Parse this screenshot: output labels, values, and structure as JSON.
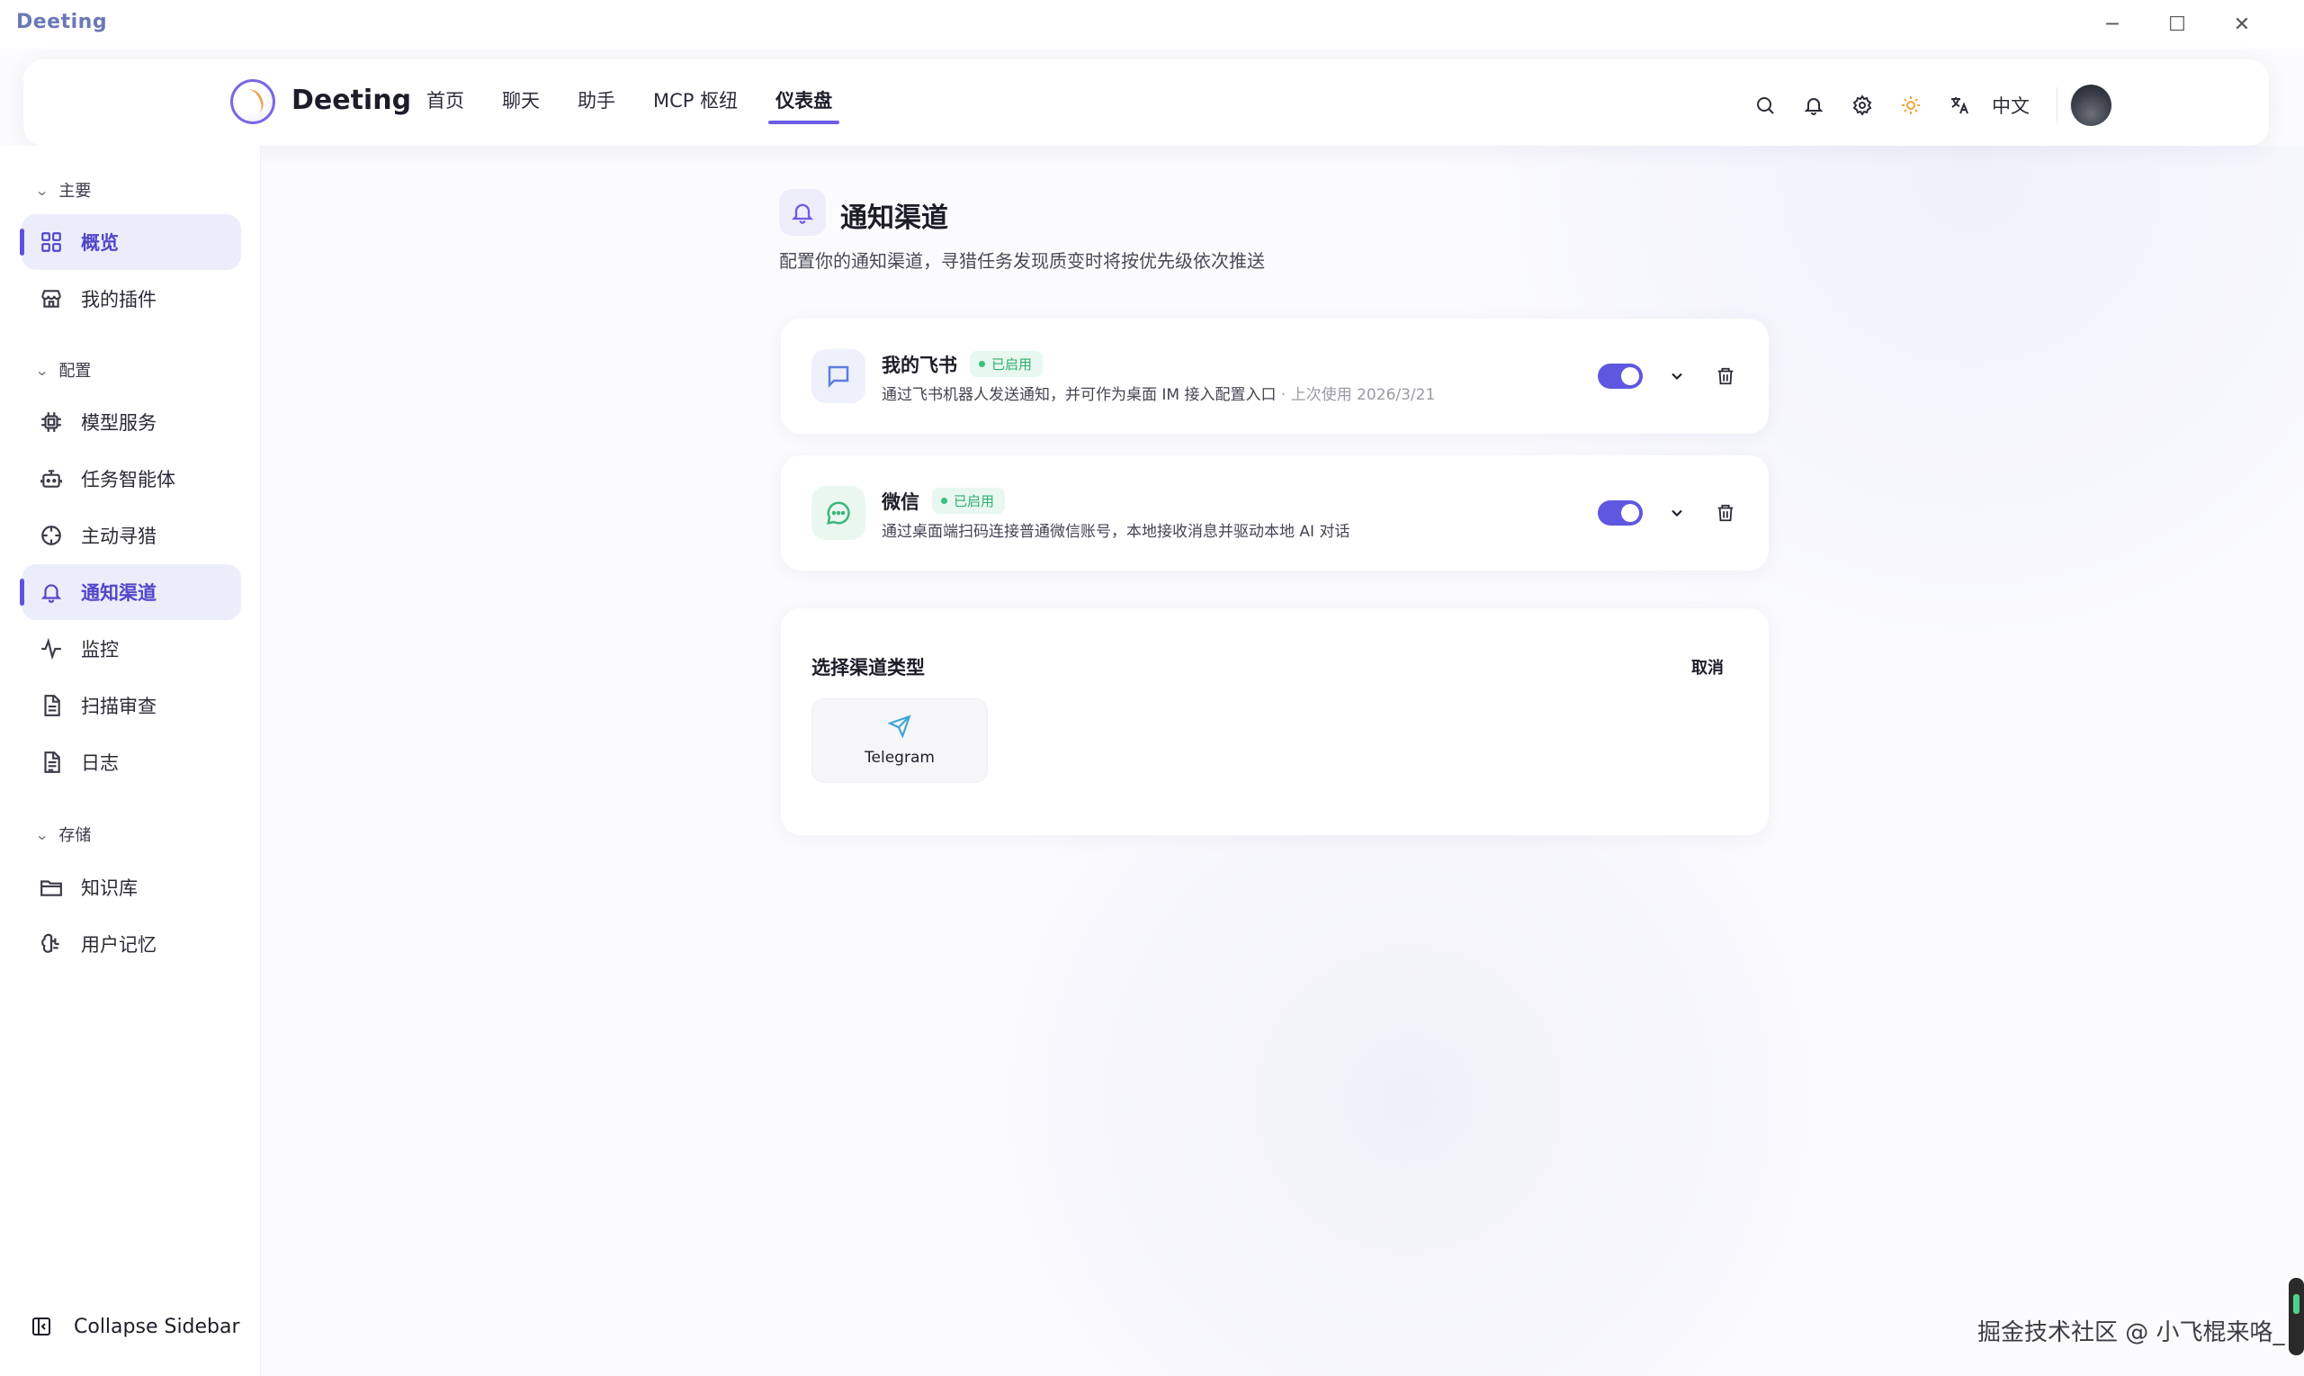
{
  "window": {
    "title": "Deeting",
    "controls": {
      "minimize": "─",
      "maximize": "☐",
      "close": "✕"
    }
  },
  "header": {
    "brand": "Deeting",
    "nav": [
      "首页",
      "聊天",
      "助手",
      "MCP 枢纽",
      "仪表盘"
    ],
    "active_nav": "仪表盘",
    "lang": "中文",
    "icons": [
      "search-icon",
      "bell-icon",
      "gear-icon",
      "sun-icon",
      "translate-icon"
    ]
  },
  "sidebar": {
    "sections": [
      {
        "title": "主要",
        "items": [
          "概览",
          "我的插件"
        ]
      },
      {
        "title": "配置",
        "items": [
          "模型服务",
          "任务智能体",
          "主动寻猎",
          "通知渠道",
          "监控",
          "扫描审查",
          "日志"
        ]
      },
      {
        "title": "存储",
        "items": [
          "知识库",
          "用户记忆"
        ]
      }
    ],
    "active_items": [
      "概览",
      "通知渠道"
    ],
    "collapse_label": "Collapse Sidebar"
  },
  "page": {
    "title": "通知渠道",
    "subtitle": "配置你的通知渠道，寻猎任务发现质变时将按优先级依次推送"
  },
  "channels": [
    {
      "name": "我的飞书",
      "status": "已启用",
      "desc": "通过飞书机器人发送通知，并可作为桌面 IM 接入配置入口",
      "meta": "· 上次使用 2026/3/21",
      "enabled": true
    },
    {
      "name": "微信",
      "status": "已启用",
      "desc": "通过桌面端扫码连接普通微信账号，本地接收消息并驱动本地 AI 对话",
      "meta": "",
      "enabled": true
    }
  ],
  "picker": {
    "title": "选择渠道类型",
    "cancel": "取消",
    "options": [
      "Telegram"
    ]
  },
  "watermark": "掘金技术社区 @ 小飞棍来咯_",
  "colors": {
    "accent": "#5f57df",
    "success": "#2fae6d",
    "success_bg": "#e8f7ef",
    "brand_title": "#6a78b8"
  }
}
